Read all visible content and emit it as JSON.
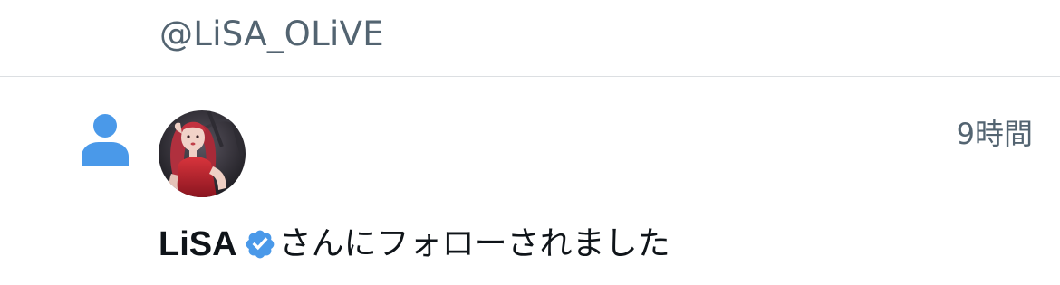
{
  "previous_item": {
    "handle": "@LiSA_OLiVE"
  },
  "notification": {
    "type_icon": "person-follow-icon",
    "avatar_icon": "user-avatar",
    "timestamp": "9時間",
    "user_name": "LiSA",
    "verified_icon": "verified-badge-icon",
    "message": "さんにフォローされました"
  },
  "colors": {
    "follow_icon": "#4a99e9",
    "verified_badge": "#4a99e9",
    "secondary_text": "#536471",
    "primary_text": "#0f1419",
    "divider": "#dcdfe2"
  }
}
